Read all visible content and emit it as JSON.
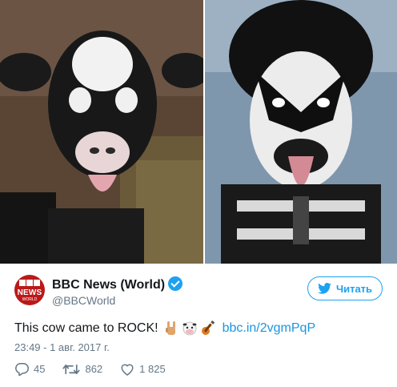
{
  "author": {
    "name": "BBC News (World)",
    "handle": "@BBCWorld",
    "avatar_text_top": "BBC",
    "avatar_text_main": "NEWS",
    "avatar_text_bottom": "WORLD"
  },
  "follow_button": {
    "label": "Читать",
    "icon": "twitter-bird-icon"
  },
  "tweet": {
    "text": "This cow came to ROCK!",
    "emojis": [
      "rock-on-hand-icon",
      "cow-face-icon",
      "guitar-icon"
    ],
    "link": "bbc.in/2vgmPqP",
    "timestamp": "23:49 - 1 авг. 2017 г."
  },
  "stats": {
    "replies": "45",
    "retweets": "862",
    "likes": "1 825"
  },
  "colors": {
    "accent": "#1da1f2",
    "link": "#1b95e0",
    "muted": "#657786",
    "bbc_red": "#bb1919"
  }
}
